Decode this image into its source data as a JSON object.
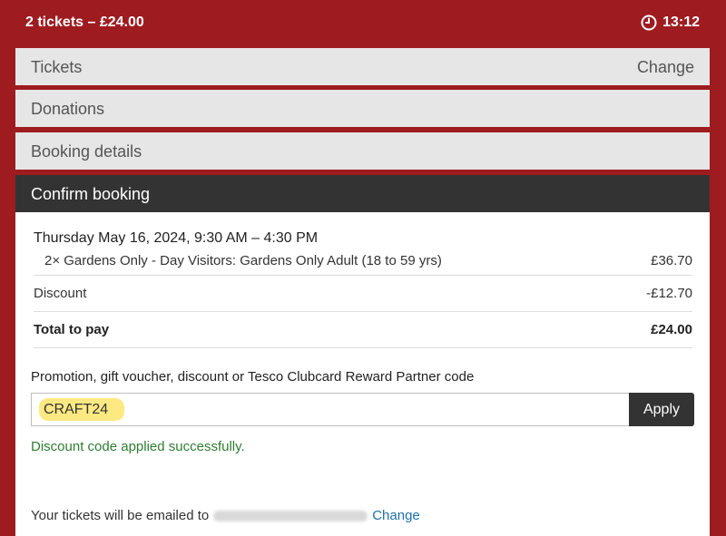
{
  "header": {
    "summary": "2 tickets – £24.00",
    "timer_icon": "clock-icon",
    "timer": "13:12"
  },
  "steps": {
    "tickets": {
      "label": "Tickets",
      "change": "Change"
    },
    "donations": {
      "label": "Donations"
    },
    "booking_details": {
      "label": "Booking details"
    }
  },
  "confirm": {
    "title": "Confirm booking",
    "date": "Thursday May 16, 2024, 9:30 AM – 4:30 PM",
    "line_items": [
      {
        "description": "2× Gardens Only - Day Visitors: Gardens Only Adult (18 to 59 yrs)",
        "price": "£36.70"
      }
    ],
    "discount": {
      "label": "Discount",
      "value": "-£12.70"
    },
    "total": {
      "label": "Total to pay",
      "value": "£24.00"
    },
    "promo": {
      "label": "Promotion, gift voucher, discount or Tesco Clubcard Reward Partner code",
      "value": "CRAFT24",
      "apply_label": "Apply",
      "success": "Discount code applied successfully."
    },
    "email": {
      "prefix": "Your tickets will be emailed to",
      "change": "Change"
    }
  },
  "colors": {
    "brand_red": "#9e1c1f",
    "dark": "#333333",
    "success_green": "#2e7d32",
    "link_blue": "#1f6fa8",
    "highlight_yellow": "#fde56c"
  }
}
